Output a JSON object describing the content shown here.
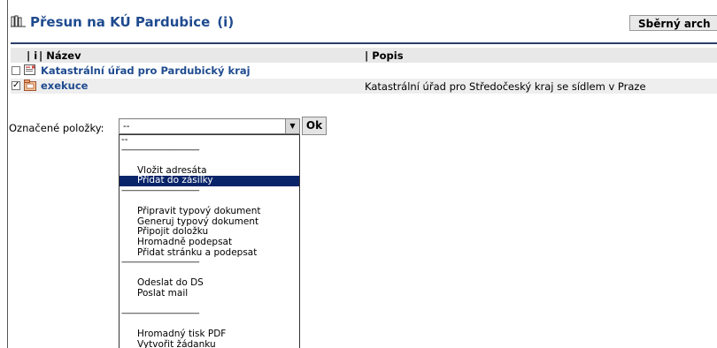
{
  "header": {
    "title": "Přesun na KÚ Pardubice",
    "info_link": "(i)",
    "archive_button": "Sběrný arch"
  },
  "columns": {
    "i": "| i",
    "name": "| Název",
    "description": "| Popis"
  },
  "rows": [
    {
      "name": "Katastrální úřad pro Pardubický kraj",
      "description": "",
      "checked": false,
      "icon": "document-icon"
    },
    {
      "name": "exekuce",
      "description": "Katastrální úřad pro Středočeský kraj se sídlem v Praze",
      "checked": true,
      "icon": "folder-icon"
    }
  ],
  "checkbox_mark": "✓",
  "marked_items": {
    "label": "Označené položky:",
    "selected_value": "--",
    "ok_button": "Ok",
    "options": [
      {
        "label": "--",
        "kind": "plain"
      },
      {
        "label": "---------------------------------------",
        "kind": "sep"
      },
      {
        "label": "",
        "kind": "blank"
      },
      {
        "label": "Vložit adresáta",
        "kind": "item"
      },
      {
        "label": "Přidat do zásilky",
        "kind": "item",
        "selected": true
      },
      {
        "label": "---------------------------------------",
        "kind": "sep"
      },
      {
        "label": "",
        "kind": "blank"
      },
      {
        "label": "Připravit typový dokument",
        "kind": "item"
      },
      {
        "label": "Generuj typový dokument",
        "kind": "item"
      },
      {
        "label": "Připojit doložku",
        "kind": "item"
      },
      {
        "label": "Hromadně podepsat",
        "kind": "item"
      },
      {
        "label": "Přidat stránku a podepsat",
        "kind": "item"
      },
      {
        "label": "---------------------------------------",
        "kind": "sep"
      },
      {
        "label": "",
        "kind": "blank"
      },
      {
        "label": "Odeslat do DS",
        "kind": "item"
      },
      {
        "label": "Poslat mail",
        "kind": "item"
      },
      {
        "label": "",
        "kind": "blank"
      },
      {
        "label": "---------------------------------------",
        "kind": "sep"
      },
      {
        "label": "",
        "kind": "blank"
      },
      {
        "label": "Hromadný tisk PDF",
        "kind": "item"
      },
      {
        "label": "Vytvořit žádanku",
        "kind": "item"
      }
    ]
  },
  "colors": {
    "title": "#1f4b8f",
    "selection": "#0a246a",
    "header_band": "#e8e8e8"
  }
}
